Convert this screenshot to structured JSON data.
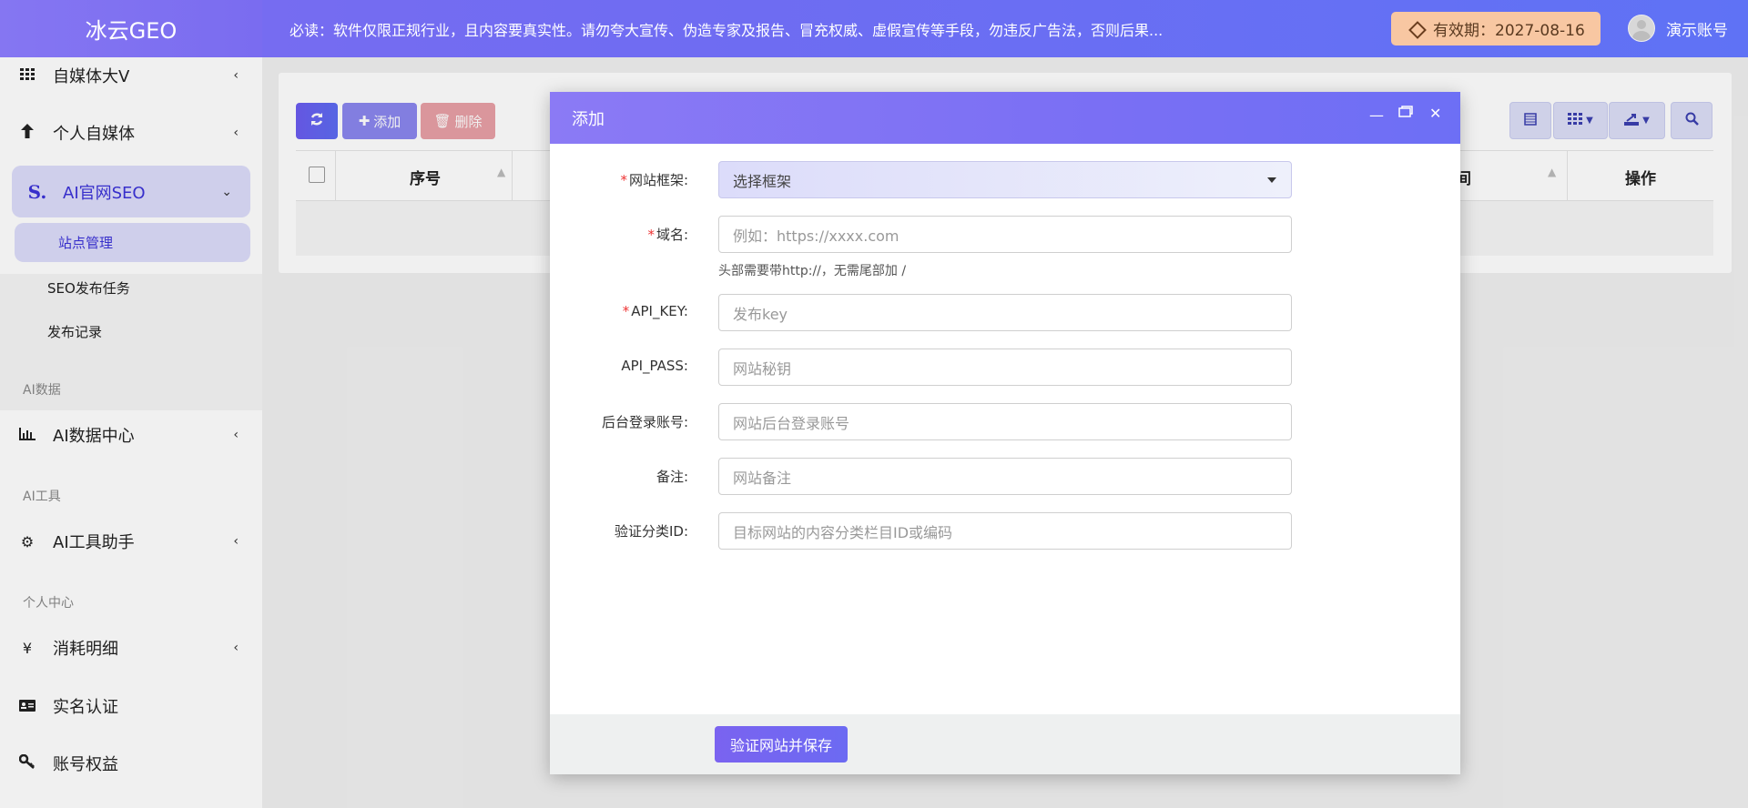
{
  "header": {
    "logo": "冰云GEO",
    "notice": "必读：软件仅限正规行业，且内容要真实性。请勿夸大宣传、伪造专家及报告、冒充权威、虚假宣传等手段，勿违反广告法，否则后果...",
    "expire": "有效期：2027-08-16",
    "username": "演示账号"
  },
  "sidebar": {
    "items": [
      {
        "label": "自媒体大V",
        "icon": "grid-icon"
      },
      {
        "label": "个人自媒体",
        "icon": "arrow-up-icon"
      },
      {
        "label": "AI官网SEO",
        "icon": "seo-s-icon"
      }
    ],
    "subitems": [
      "站点管理",
      "SEO发布任务",
      "发布记录"
    ],
    "section_ai_data": "AI数据",
    "ai_data_center": "AI数据中心",
    "section_ai_tools": "AI工具",
    "ai_tools_helper": "AI工具助手",
    "section_personal": "个人中心",
    "consume_detail": "消耗明细",
    "realname": "实名认证",
    "account_rights": "账号权益"
  },
  "toolbar": {
    "add": "添加",
    "delete": "删除"
  },
  "table": {
    "col_index": "序号",
    "col_time_fragment": "间",
    "col_action": "操作"
  },
  "modal": {
    "title": "添加",
    "fields": {
      "framework_label": "网站框架:",
      "framework_value": "选择框架",
      "domain_label": "域名:",
      "domain_placeholder": "例如：https://xxxx.com",
      "domain_hint": "头部需要带http://，无需尾部加 /",
      "apikey_label": "API_KEY:",
      "apikey_placeholder": "发布key",
      "apipass_label": "API_PASS:",
      "apipass_placeholder": "网站秘钥",
      "admin_label": "后台登录账号:",
      "admin_placeholder": "网站后台登录账号",
      "remark_label": "备注:",
      "remark_placeholder": "网站备注",
      "catid_label": "验证分类ID:",
      "catid_placeholder": "目标网站的内容分类栏目ID或编码"
    },
    "save": "验证网站并保存"
  }
}
